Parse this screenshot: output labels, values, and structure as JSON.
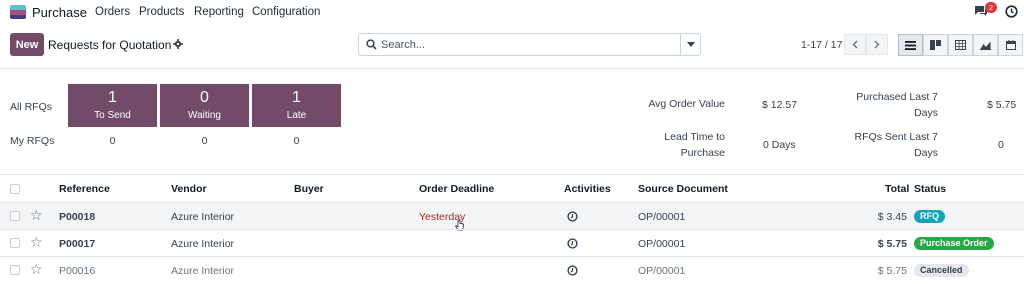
{
  "navbar": {
    "app_name": "Purchase",
    "menu": [
      "Orders",
      "Products",
      "Reporting",
      "Configuration"
    ],
    "chat_count": "2",
    "icons": [
      "apps-logo-icon",
      "chat-icon",
      "clock-icon"
    ]
  },
  "control": {
    "new_label": "New",
    "title": "Requests for Quotation",
    "search_placeholder": "Search...",
    "pager": "1-17 / 17",
    "views": [
      "list",
      "kanban",
      "calendar-grid",
      "graph",
      "calendar"
    ]
  },
  "dashboard": {
    "all_rfqs_label": "All RFQs",
    "my_rfqs_label": "My RFQs",
    "tiles": [
      {
        "count": "1",
        "label": "To Send"
      },
      {
        "count": "0",
        "label": "Waiting"
      },
      {
        "count": "1",
        "label": "Late"
      }
    ],
    "my_values": [
      "0",
      "0",
      "0"
    ],
    "stats": {
      "avg_order_value_label": "Avg Order Value",
      "avg_order_value": "$ 12.57",
      "purchased_last7_label": [
        "Purchased Last 7",
        "Days"
      ],
      "purchased_last7": "$ 5.75",
      "lead_time_label": [
        "Lead Time to",
        "Purchase"
      ],
      "lead_time": "0 Days",
      "rfqs_sent_label": [
        "RFQs Sent Last 7",
        "Days"
      ],
      "rfqs_sent": "0"
    }
  },
  "table": {
    "headers": {
      "reference": "Reference",
      "vendor": "Vendor",
      "buyer": "Buyer",
      "deadline": "Order Deadline",
      "activities": "Activities",
      "source": "Source Document",
      "total": "Total",
      "status": "Status"
    },
    "rows": [
      {
        "reference": "P00018",
        "vendor": "Azure Interior",
        "buyer": "",
        "deadline": "Yesterday",
        "source": "OP/00001",
        "total": "$ 3.45",
        "status": "RFQ",
        "status_color": "#17a2b8"
      },
      {
        "reference": "P00017",
        "vendor": "Azure Interior",
        "buyer": "",
        "deadline": "",
        "source": "OP/00001",
        "total": "$ 5.75",
        "status": "Purchase Order",
        "status_color": "#28a745"
      },
      {
        "reference": "P00016",
        "vendor": "Azure Interior",
        "buyer": "",
        "deadline": "",
        "source": "OP/00001",
        "total": "$ 5.75",
        "status": "Cancelled",
        "status_color": "#e5e7eb"
      }
    ]
  },
  "colors": {
    "brand": "#714b67",
    "danger": "#b42318",
    "badge_red": "#e23a3a"
  }
}
